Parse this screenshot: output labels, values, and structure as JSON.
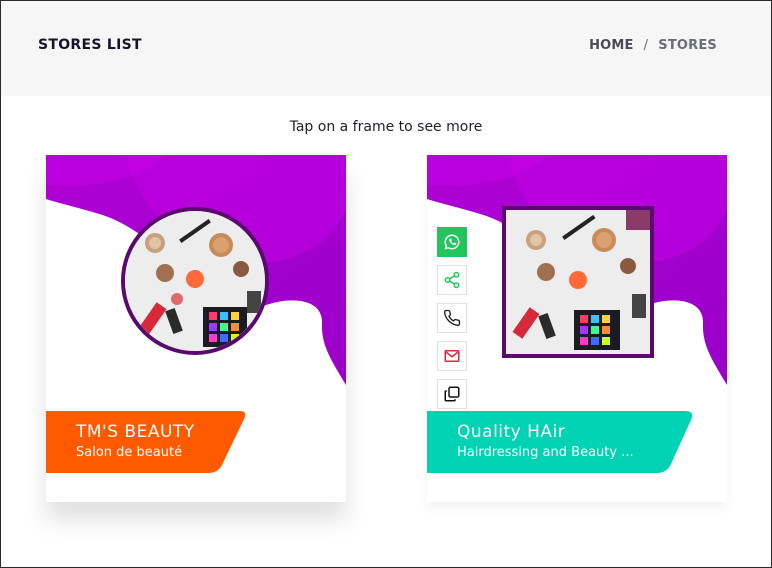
{
  "header": {
    "title": "STORES LIST",
    "breadcrumb": {
      "home": "HOME",
      "separator": "/",
      "current": "STORES"
    }
  },
  "hint": "Tap on a frame to see more",
  "stores": [
    {
      "name": "TM'S BEAUTY",
      "subtitle": "Salon de beauté",
      "band_color": "#ff5a00"
    },
    {
      "name": "Quality HAir",
      "subtitle": "Hairdressing and Beauty ...",
      "band_color": "#00d3b4",
      "actions": [
        "whatsapp-icon",
        "share-icon",
        "phone-icon",
        "mail-icon",
        "copy-icon"
      ]
    }
  ],
  "colors": {
    "purple": "#b400d8",
    "frame_border": "#5a0a6e",
    "whatsapp": "#22c55e"
  }
}
